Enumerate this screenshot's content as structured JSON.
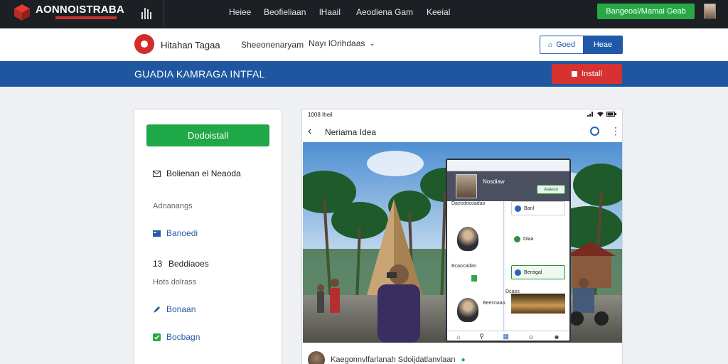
{
  "topnav": {
    "logo": "AONNOISTRABA",
    "items": [
      "Heiee",
      "Beofieliaan",
      "lHaail",
      "Aeodiena Gam",
      "Keeial"
    ],
    "cta": "Bangeoal/Mamai Geab"
  },
  "subheader": {
    "brand": "Hitahan Tagaa",
    "link": "Sheeonenaryam",
    "dropdown": "Nayı lOrihdaas",
    "btn_outline": "Goed",
    "btn_solid": "Heae"
  },
  "banner": {
    "title": "GUADIA KAMRAGA INTFAL",
    "button": "Install"
  },
  "left": {
    "cta": "Dodoistall",
    "row1": "Bolienan el Neaoda",
    "muted1": "Adnanangs",
    "row2": "Banoedi",
    "num": "13",
    "row3": "Beddiaoes",
    "muted2": "Hots dolrass",
    "row4": "Bonaan",
    "row5": "Bocbagn"
  },
  "right": {
    "status_time": "1008 Iheil",
    "app_title": "Neriama Idea",
    "footer": "Kaegonnvlfarlanah Sdoijdatlanvlaan"
  },
  "phone": {
    "name": "Nosdiaw",
    "pill": "Aiaesoi",
    "l1": "Daeodocoadao",
    "r1": "Banl",
    "r2": "Diaa",
    "l2": "Bcaocadao",
    "l3": "Beecnaaoao",
    "r3": "Bensgal",
    "l4": "Dcaes"
  },
  "colors": {
    "nav_bg": "#1c1f24",
    "accent_blue": "#1e56a0",
    "green": "#1fa847",
    "red": "#d73131"
  }
}
